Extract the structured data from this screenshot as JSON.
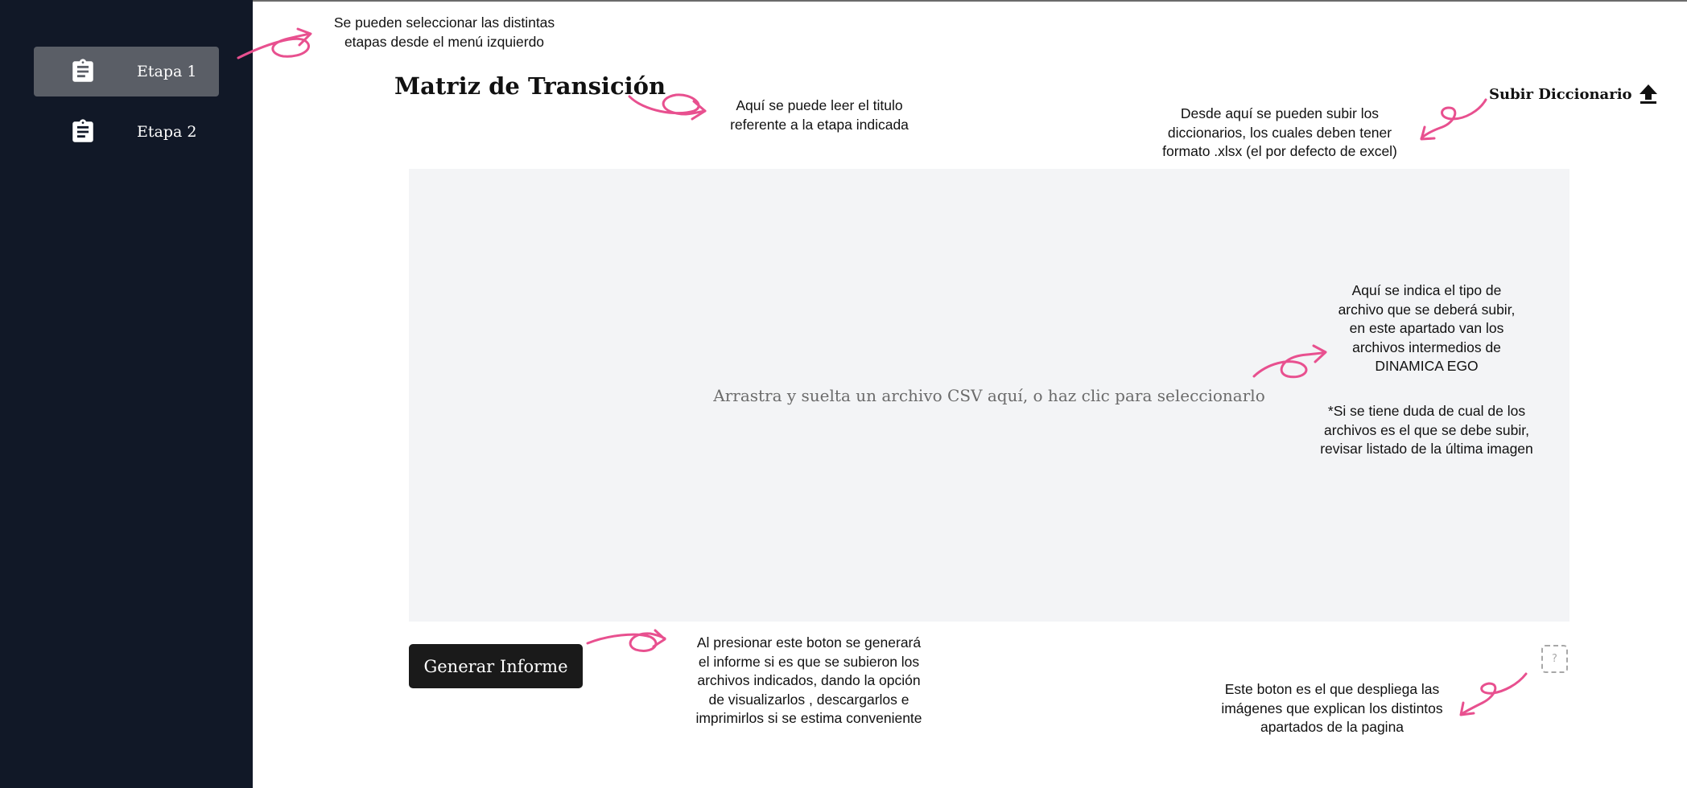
{
  "sidebar": {
    "items": [
      {
        "label": "Etapa 1",
        "icon": "clipboard-icon",
        "active": true
      },
      {
        "label": "Etapa 2",
        "icon": "clipboard-icon",
        "active": false
      }
    ]
  },
  "main": {
    "title": "Matriz de Transición",
    "upload_dictionary_label": "Subir Diccionario",
    "dropzone_text": "Arrastra y suelta un archivo CSV aquí, o haz clic para seleccionarlo",
    "generate_button_label": "Generar Informe",
    "help_button_label": "?"
  },
  "annotations": {
    "sidebar_note": "Se pueden seleccionar las distintas\netapas desde el menú izquierdo",
    "title_note": "Aquí se puede leer el titulo\nreferente a la etapa indicada",
    "upload_note": "Desde aquí se pueden subir los\ndiccionarios, los cuales deben tener\nformato .xlsx (el por defecto de excel)",
    "dropzone_note": "Aquí se indica el tipo de\narchivo que se deberá subir,\nen este apartado van los\narchivos intermedios de\nDINAMICA EGO",
    "dropzone_note_2": "*Si se tiene duda de cual de los\narchivos es el que se debe subir,\nrevisar listado de la última imagen",
    "generate_note": "Al presionar este boton se generará\nel informe si es que se subieron los\narchivos indicados, dando la opción\nde visualizarlos , descargarlos e\nimprimirlos si se estima conveniente",
    "help_note": "Este boton es el que despliega las\nimágenes que explican los distintos\napartados de la pagina"
  },
  "colors": {
    "sidebar_bg": "#111827",
    "sidebar_active_bg": "#5a5e66",
    "dropzone_bg": "#f3f4f6",
    "button_bg": "#1a1a1a",
    "annotation_arrow": "#e8508f"
  }
}
